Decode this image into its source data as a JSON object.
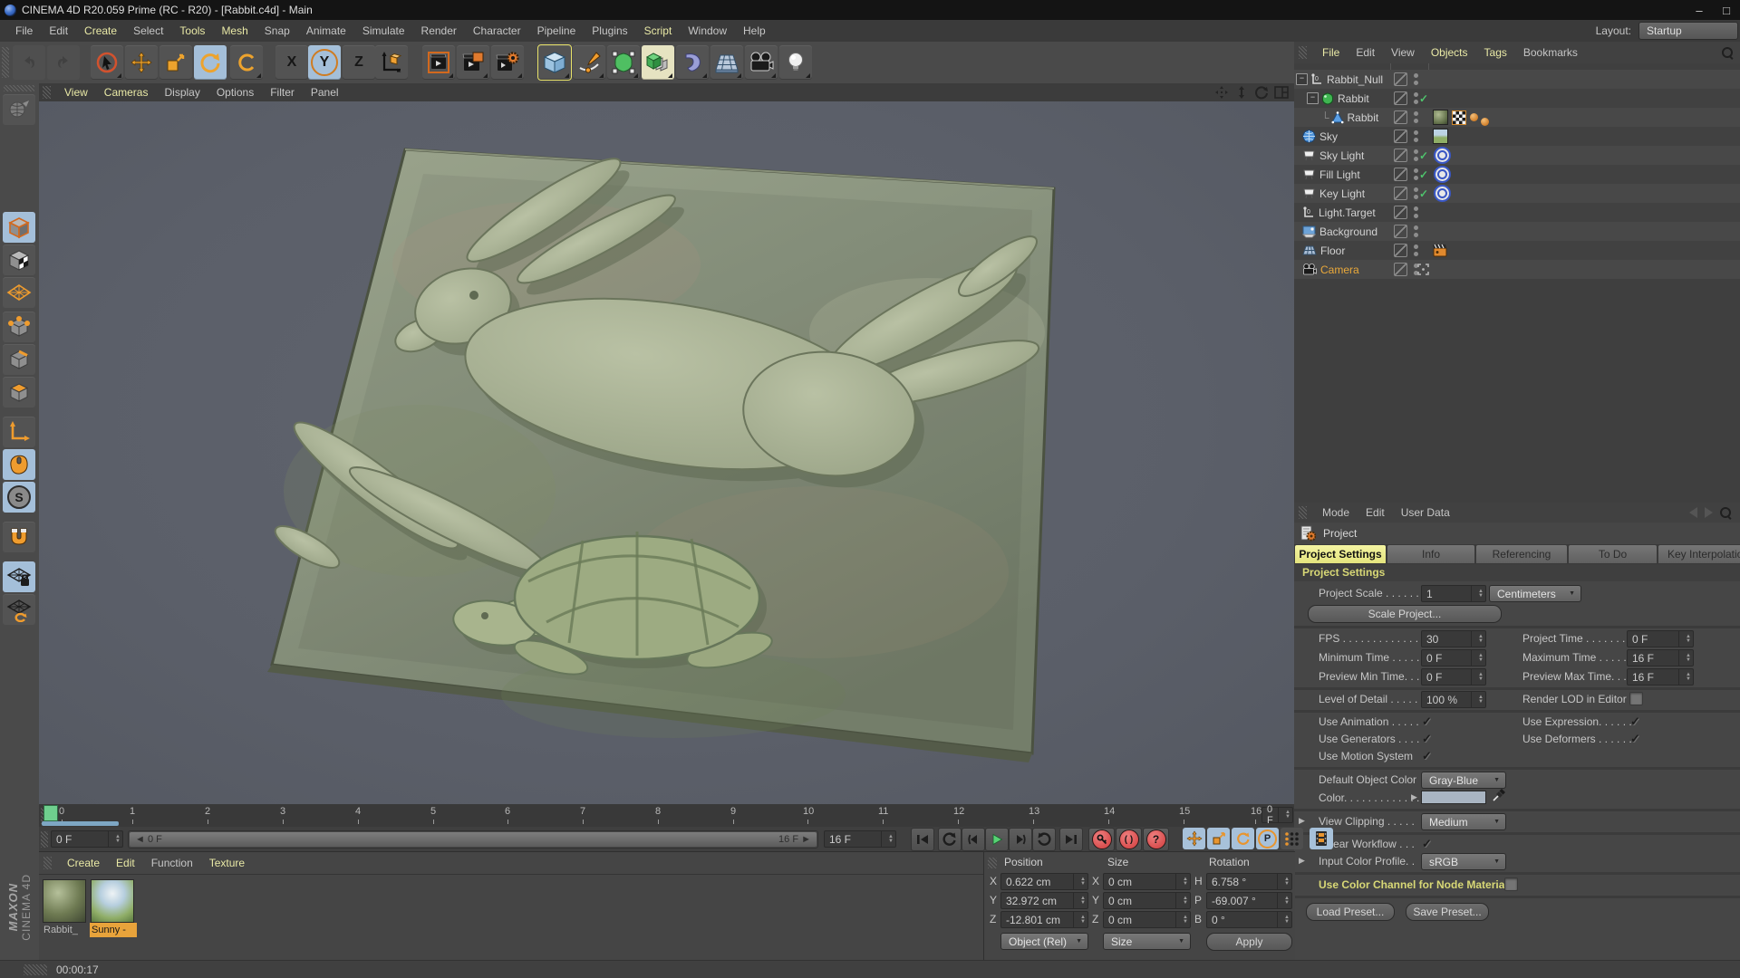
{
  "window": {
    "title": "CINEMA 4D R20.059 Prime (RC - R20) - [Rabbit.c4d] - Main",
    "minimize": "–",
    "maximize": "□"
  },
  "menu_bar": {
    "items": [
      "File",
      "Edit",
      "Create",
      "Select",
      "Tools",
      "Mesh",
      "Snap",
      "Animate",
      "Simulate",
      "Render",
      "Character",
      "Pipeline",
      "Plugins",
      "Script",
      "Window",
      "Help"
    ],
    "layout_label": "Layout:",
    "layout_value": "Startup"
  },
  "toolbar": {
    "axis_x": "X",
    "axis_y": "Y",
    "axis_z": "Z"
  },
  "viewport": {
    "menus": [
      "View",
      "Cameras",
      "Display",
      "Options",
      "Filter",
      "Panel"
    ]
  },
  "object_manager": {
    "menus": [
      "File",
      "Edit",
      "View",
      "Objects",
      "Tags",
      "Bookmarks"
    ],
    "tree": [
      {
        "label": "Rabbit_Null"
      },
      {
        "label": "Rabbit"
      },
      {
        "label": "Rabbit"
      },
      {
        "label": "Sky"
      },
      {
        "label": "Sky Light"
      },
      {
        "label": "Fill Light"
      },
      {
        "label": "Key Light"
      },
      {
        "label": "Light.Target"
      },
      {
        "label": "Background"
      },
      {
        "label": "Floor"
      },
      {
        "label": "Camera"
      }
    ]
  },
  "attribute_manager": {
    "menus": [
      "Mode",
      "Edit",
      "User Data"
    ],
    "object_label": "Project",
    "tabs": [
      "Project Settings",
      "Info",
      "Referencing",
      "To Do",
      "Key Interpolation"
    ],
    "section_title": "Project Settings",
    "fields": {
      "project_scale_label": "Project Scale . . . . . . .",
      "project_scale_value": "1",
      "project_scale_unit": "Centimeters",
      "scale_project_button": "Scale Project...",
      "fps_label": "FPS . . . . . . . . . . . . . .",
      "fps_value": "30",
      "project_time_label": "Project Time . . . . . . . .",
      "project_time_value": "0 F",
      "minimum_time_label": "Minimum Time . . . . .",
      "minimum_time_value": "0 F",
      "maximum_time_label": "Maximum Time . . . . . .",
      "maximum_time_value": "16 F",
      "preview_min_label": "Preview Min Time. . .",
      "preview_min_value": "0 F",
      "preview_max_label": "Preview Max Time. . . .",
      "preview_max_value": "16 F",
      "lod_label": "Level of Detail . . . . .",
      "lod_value": "100 %",
      "render_lod_label": "Render LOD in Editor",
      "use_animation_label": "Use Animation . . . . .",
      "use_expression_label": "Use Expression. . . . . .",
      "use_generators_label": "Use Generators . . . .",
      "use_deformers_label": "Use Deformers . . . . . .",
      "use_motion_label": "Use Motion System",
      "default_color_label": "Default Object Color",
      "default_color_value": "Gray-Blue",
      "color_label": "Color. . . . . . . . . . . . .",
      "view_clipping_label": "View Clipping . . . . .",
      "view_clipping_value": "Medium",
      "linear_workflow_label": "Linear Workflow . . .",
      "input_profile_label": "Input Color Profile. .",
      "input_profile_value": "sRGB",
      "node_material_label": "Use Color Channel for Node Material",
      "load_preset_button": "Load Preset...",
      "save_preset_button": "Save Preset..."
    },
    "colors": {
      "swatch": "#a9b5c2",
      "tab_active": "#e9e98b",
      "accent_orange": "#f0a132"
    }
  },
  "timeline": {
    "ticks": [
      "0",
      "1",
      "2",
      "3",
      "4",
      "5",
      "6",
      "7",
      "8",
      "9",
      "10",
      "11",
      "12",
      "13",
      "14",
      "15",
      "16"
    ],
    "current_frame": "0 F",
    "frame_start": "0 F",
    "frame_end": "16 F",
    "range_start": "◄ 0 F",
    "range_end": "16 F ►"
  },
  "transport": {
    "parameter_label": "P",
    "autokey_label": "( )",
    "question_label": "?"
  },
  "materials": {
    "menus": [
      "Create",
      "Edit",
      "Function",
      "Texture"
    ],
    "items": [
      {
        "name": "Rabbit_",
        "selected": false
      },
      {
        "name": "Sunny -",
        "selected": true
      }
    ],
    "brand_maxon": "MAXON",
    "brand_c4d": "CINEMA 4D"
  },
  "coordinates": {
    "headers": [
      "Position",
      "Size",
      "Rotation"
    ],
    "position": {
      "x_label": "X",
      "x": "0.622 cm",
      "y_label": "Y",
      "y": "32.972 cm",
      "z_label": "Z",
      "z": "-12.801 cm"
    },
    "size": {
      "x_label": "X",
      "x": "0 cm",
      "y_label": "Y",
      "y": "0 cm",
      "z_label": "Z",
      "z": "0 cm"
    },
    "rotation": {
      "h_label": "H",
      "h": "6.758 °",
      "p_label": "P",
      "p": "-69.007 °",
      "b_label": "B",
      "b": "0 °"
    },
    "mode_value": "Object (Rel)",
    "size_mode_value": "Size",
    "apply_button": "Apply"
  },
  "status_bar": {
    "time": "00:00:17"
  },
  "glyphs": {
    "check": "✓",
    "expander_minus": "−"
  }
}
